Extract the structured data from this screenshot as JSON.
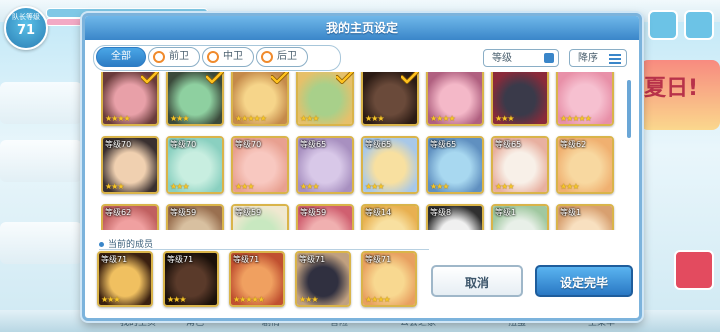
{
  "background": {
    "player_level_label": "队长等级",
    "player_level": "71",
    "event_text": "夏日!",
    "bottom_nav": [
      "我的主页",
      "角色",
      "剧情",
      "冒险",
      "公会之家",
      "扭蛋",
      "主菜单"
    ]
  },
  "modal": {
    "title": "我的主页设定",
    "tabs": [
      {
        "label": "全部",
        "active": true
      },
      {
        "label": "前卫",
        "active": false
      },
      {
        "label": "中卫",
        "active": false
      },
      {
        "label": "后卫",
        "active": false
      }
    ],
    "sort_label": "等级",
    "order_label": "降序",
    "cards": [
      {
        "level": "",
        "stars": "★★★★",
        "checked": true,
        "c1": "#e8a0a8",
        "c2": "#6a3b3b"
      },
      {
        "level": "",
        "stars": "★★★",
        "checked": true,
        "c1": "#8ed0a0",
        "c2": "#3b4a3b"
      },
      {
        "level": "",
        "stars": "★★★★★",
        "checked": true,
        "c1": "#f6d58a",
        "c2": "#c58a4a"
      },
      {
        "level": "",
        "stars": "★★★",
        "checked": true,
        "c1": "#a8d08a",
        "c2": "#e6c06a"
      },
      {
        "level": "",
        "stars": "★★★",
        "checked": true,
        "c1": "#6a4a3a",
        "c2": "#2b1b14"
      },
      {
        "level": "",
        "stars": "★★★★",
        "checked": false,
        "c1": "#f4b8c8",
        "c2": "#b06080"
      },
      {
        "level": "",
        "stars": "★★★",
        "checked": false,
        "c1": "#3a3a4a",
        "c2": "#8a2a3a"
      },
      {
        "level": "",
        "stars": "★★★★★",
        "checked": false,
        "c1": "#f6c0d0",
        "c2": "#e890a8"
      },
      {
        "level": "等级70",
        "stars": "★★★",
        "checked": false,
        "c1": "#f0d0b0",
        "c2": "#3a3030"
      },
      {
        "level": "等级70",
        "stars": "★★★",
        "checked": false,
        "c1": "#c8eee0",
        "c2": "#8ad0c0"
      },
      {
        "level": "等级70",
        "stars": "★★★",
        "checked": false,
        "c1": "#f8c8c0",
        "c2": "#e8a090"
      },
      {
        "level": "等级65",
        "stars": "★★★",
        "checked": false,
        "c1": "#d8c8e8",
        "c2": "#a890c0"
      },
      {
        "level": "等级65",
        "stars": "★★★",
        "checked": false,
        "c1": "#f8e0a0",
        "c2": "#a8c8e8"
      },
      {
        "level": "等级65",
        "stars": "★★★",
        "checked": false,
        "c1": "#a8d8f0",
        "c2": "#6090c0"
      },
      {
        "level": "等级65",
        "stars": "★★★",
        "checked": false,
        "c1": "#f8f0e8",
        "c2": "#e8b0a0"
      },
      {
        "level": "等级62",
        "stars": "★★★",
        "checked": false,
        "c1": "#f8d8a0",
        "c2": "#f0b070"
      },
      {
        "level": "等级62",
        "stars": "★★",
        "checked": false,
        "c1": "#f0a0a0",
        "c2": "#c06060"
      },
      {
        "level": "等级59",
        "stars": "★★",
        "checked": false,
        "c1": "#d8c0a0",
        "c2": "#9a7050"
      },
      {
        "level": "等级59",
        "stars": "★★",
        "checked": false,
        "c1": "#c8e8c0",
        "c2": "#f0e8d0"
      },
      {
        "level": "等级59",
        "stars": "★★",
        "checked": false,
        "c1": "#f0b0b0",
        "c2": "#d06070"
      },
      {
        "level": "等级14",
        "stars": "★★",
        "checked": false,
        "c1": "#f8e0a0",
        "c2": "#e8b050"
      },
      {
        "level": "等级8",
        "stars": "★",
        "checked": false,
        "c1": "#f0f0f0",
        "c2": "#303030"
      },
      {
        "level": "等级1",
        "stars": "★",
        "checked": false,
        "c1": "#e8f0e8",
        "c2": "#a0c8a0"
      },
      {
        "level": "等级1",
        "stars": "★",
        "checked": false,
        "c1": "#f8e0c0",
        "c2": "#d8a070"
      }
    ],
    "current_members_label": "当前的成员",
    "current": [
      {
        "level": "等级71",
        "stars": "★★★",
        "c1": "#f0c060",
        "c2": "#3a2010"
      },
      {
        "level": "等级71",
        "stars": "★★★",
        "c1": "#5a3a2a",
        "c2": "#1a100a"
      },
      {
        "level": "等级71",
        "stars": "★★★★★",
        "c1": "#f0a060",
        "c2": "#c05030"
      },
      {
        "level": "等级71",
        "stars": "★★★",
        "c1": "#303040",
        "c2": "#c0a080"
      },
      {
        "level": "等级71",
        "stars": "★★★★",
        "c1": "#f8d890",
        "c2": "#e8a060"
      }
    ],
    "cancel_label": "取消",
    "confirm_label": "设定完毕"
  }
}
